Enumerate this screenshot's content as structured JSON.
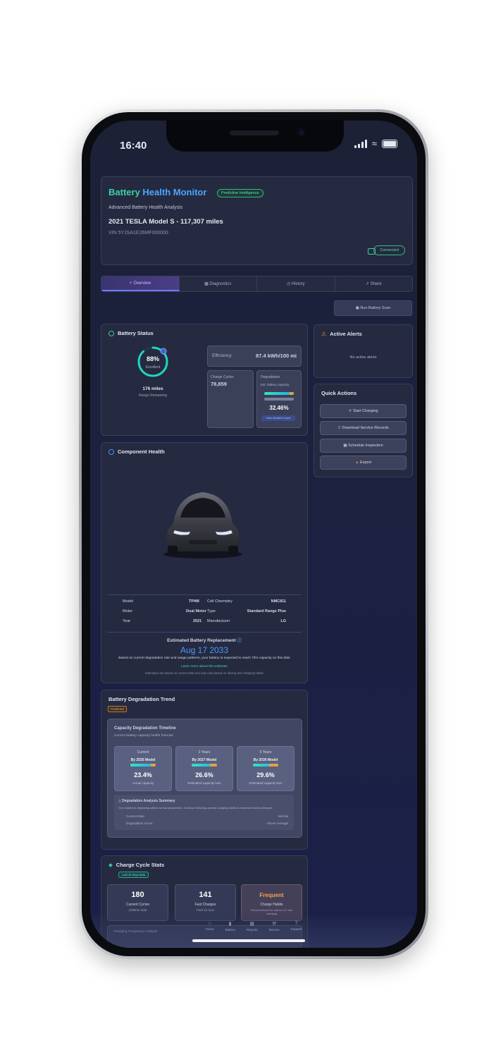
{
  "status": {
    "time": "16:40"
  },
  "header": {
    "title_a": "Battery",
    "title_b": "Health Monitor",
    "badge": "Predictive Intelligence",
    "subtitle": "Advanced Battery Health Analysis",
    "vehicle": "2021 TESLA Model S - 117,307 miles",
    "vin": "VIN 5YJSA1E26MF000000",
    "connected": "Connected"
  },
  "tabs": [
    {
      "label": "Overview",
      "icon": "bolt"
    },
    {
      "label": "Diagnostics",
      "icon": "chart"
    },
    {
      "label": "History",
      "icon": "clock"
    },
    {
      "label": "Share",
      "icon": "share"
    }
  ],
  "actions": {
    "run_scan": "Run Battery Scan"
  },
  "battery_status": {
    "title": "Battery Status",
    "soc": "88%",
    "soc_label": "Excellent",
    "soc_level": 0.88,
    "range": "176 miles",
    "range_sub": "Range Remaining",
    "efficiency_label": "Efficiency",
    "efficiency_value": "87.4 kWh/100 mi",
    "charge_label": "Charge Cycles",
    "charge_value": "78,859",
    "degradation_label": "Degradation",
    "degradation_sub": "Est. battery capacity",
    "degradation_value": "32.46%",
    "degradation_level": 0.85,
    "degradation_btn": "View detailed report"
  },
  "alerts": {
    "title": "Active Alerts",
    "empty": "No active alerts"
  },
  "quick_actions": {
    "title": "Quick Actions",
    "items": [
      "Start Charging",
      "Download Service Records",
      "Schedule Inspection",
      "Export"
    ]
  },
  "component_health": {
    "title": "Component Health",
    "specs_left": [
      {
        "k": "Model",
        "v": "TP4M"
      },
      {
        "k": "Motor",
        "v": "Dual Motor"
      },
      {
        "k": "Year",
        "v": "2021"
      }
    ],
    "specs_right": [
      {
        "k": "Cell Chemistry",
        "v": "NMC811"
      },
      {
        "k": "Type",
        "v": "Standard Range Plus"
      },
      {
        "k": "Manufacturer",
        "v": "LG"
      }
    ],
    "replacement_title": "Estimated Battery Replacement",
    "replacement_date": "Aug 17 2033",
    "replacement_desc": "Based on current degradation rate and usage patterns, your battery is expected to reach 70% capacity on this date",
    "replacement_link": "Learn more about this estimate",
    "replacement_note": "Estimates are based on current data and may vary based on driving and charging habits"
  },
  "degradation_trend": {
    "title": "Battery Degradation Trend",
    "badge": "Predicted",
    "inner_title": "Capacity Degradation Timeline",
    "inner_sub": "Current battery capacity health forecast",
    "stats": [
      {
        "period": "Current",
        "label": "By 2025 Model",
        "value": "23.4%",
        "level": 0.8,
        "caption": "Actual capacity"
      },
      {
        "period": "2 Years",
        "label": "By 2027 Model",
        "value": "26.6%",
        "level": 0.72,
        "caption": "Estimated capacity loss"
      },
      {
        "period": "5 Years",
        "label": "By 2030 Model",
        "value": "29.6%",
        "level": 0.65,
        "caption": "Estimated capacity loss"
      }
    ],
    "analysis_title": "Degradation Analysis Summary",
    "analysis_desc": "Your battery is degrading within normal parameters. Continue following optimal charging habits to maximize battery lifespan.",
    "rows": [
      {
        "k": "Current Rate",
        "v": "Normal"
      },
      {
        "k": "Degradation Score",
        "v": "Above Average"
      }
    ]
  },
  "charge_cycles": {
    "title": "Charge Cycle Stats",
    "badge": "Last 30 days data",
    "boxes": [
      {
        "value": "180",
        "label": "Current Cycles",
        "sub": "Lifetime total"
      },
      {
        "value": "141",
        "label": "Fast Charges",
        "sub": "Past 12 mos"
      },
      {
        "value": "Frequent",
        "label": "Charge Habits",
        "sub": "Recommended to reduce DC fast charging"
      }
    ],
    "next_section": "Charging Frequency Analysis"
  },
  "bottom_nav": [
    "Home",
    "Battery",
    "Reports",
    "Service",
    "Support"
  ],
  "colors": {
    "accent_green": "#39d3a5",
    "accent_blue": "#4aa7ff",
    "amber": "#e8a23a"
  }
}
